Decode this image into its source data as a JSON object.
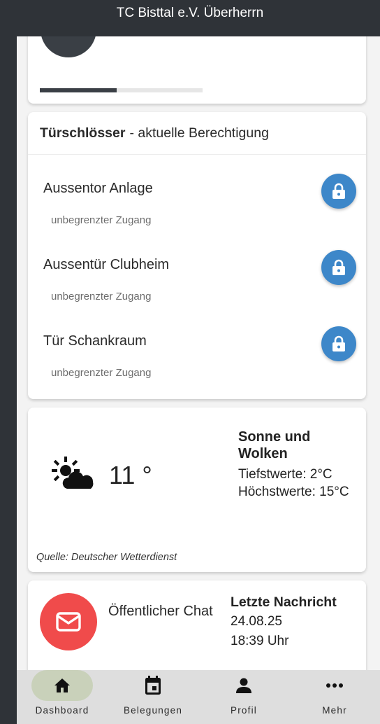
{
  "app": {
    "title": "TC Bisttal e.V. Überherrn"
  },
  "top_card": {
    "progress_fraction": 0.47
  },
  "locks": {
    "header_bold": "Türschlösser",
    "header_rest": "- aktuelle Berechtigung",
    "items": [
      {
        "name": "Aussentor Anlage",
        "access": "unbegrenzter Zugang",
        "icon": "lock-icon"
      },
      {
        "name": "Aussentür Clubheim",
        "access": "unbegrenzter Zugang",
        "icon": "lock-icon"
      },
      {
        "name": "Tür Schankraum",
        "access": "unbegrenzter Zugang",
        "icon": "lock-icon"
      }
    ],
    "accent_color": "#3d87c9"
  },
  "weather": {
    "icon": "sun-cloud-icon",
    "temperature": "11 °",
    "condition": "Sonne und Wolken",
    "min": "Tiefstwerte: 2°C",
    "max": "Höchstwerte: 15°C",
    "source": "Quelle: Deutscher Wetterdienst"
  },
  "chat": {
    "icon": "mail-icon",
    "label": "Öffentlicher Chat",
    "last_title": "Letzte Nachricht",
    "last_date": "24.08.25",
    "last_time": "18:39 Uhr",
    "accent_color": "#f04b4b"
  },
  "nav": {
    "items": [
      {
        "label": "Dashboard",
        "icon": "home-icon",
        "active": true
      },
      {
        "label": "Belegungen",
        "icon": "calendar-icon",
        "active": false
      },
      {
        "label": "Profil",
        "icon": "person-icon",
        "active": false
      },
      {
        "label": "Mehr",
        "icon": "more-icon",
        "active": false
      }
    ]
  }
}
